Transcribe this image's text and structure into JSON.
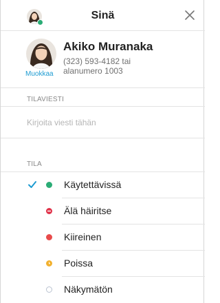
{
  "header": {
    "title": "Sinä",
    "close_icon": "close-icon"
  },
  "profile": {
    "name": "Akiko Muranaka",
    "phone_line1": "(323) 593-4182 tai",
    "phone_line2": "alanumero 1003",
    "edit_label": "Muokkaa"
  },
  "status_message": {
    "section_label": "TILAVIESTI",
    "placeholder": "Kirjoita viesti tähän"
  },
  "status": {
    "section_label": "TILA",
    "items": [
      {
        "label": "Käytettävissä",
        "color": "#2bac76",
        "selected": true,
        "icon": "available-dot-icon"
      },
      {
        "label": "Älä häiritse",
        "color": "#e0334a",
        "selected": false,
        "icon": "do-not-disturb-icon"
      },
      {
        "label": "Kiireinen",
        "color": "#e84b4b",
        "selected": false,
        "icon": "busy-dot-icon"
      },
      {
        "label": "Poissa",
        "color": "#f2b12f",
        "selected": false,
        "icon": "away-dot-icon"
      },
      {
        "label": "Näkymätön",
        "color": "#b9c2d0",
        "selected": false,
        "icon": "invisible-dot-icon"
      }
    ]
  },
  "colors": {
    "accent": "#1d9bd1",
    "available": "#2bac76"
  }
}
